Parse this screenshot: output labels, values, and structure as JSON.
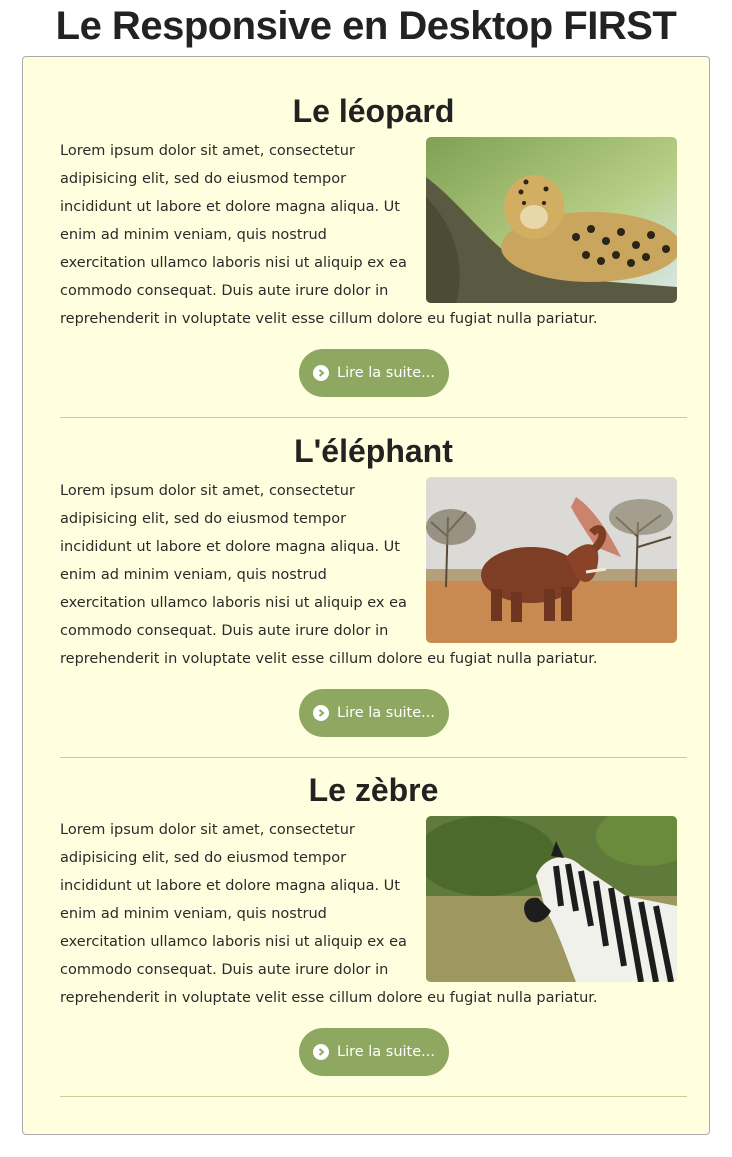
{
  "page": {
    "title": "Le Responsive en Desktop FIRST"
  },
  "articles": [
    {
      "title": "Le léopard",
      "text": "Lorem ipsum dolor sit amet, consectetur adipisicing elit, sed do eiusmod tempor incididunt ut labore et dolore magna aliqua. Ut enim ad minim veniam, quis nostrud exercitation ullamco laboris nisi ut aliquip ex ea commodo consequat. Duis aute irure dolor in reprehenderit in voluptate velit esse cillum dolore eu fugiat nulla pariatur.",
      "button_label": "Lire la suite..."
    },
    {
      "title": "L'éléphant",
      "text": "Lorem ipsum dolor sit amet, consectetur adipisicing elit, sed do eiusmod tempor incididunt ut labore et dolore magna aliqua. Ut enim ad minim veniam, quis nostrud exercitation ullamco laboris nisi ut aliquip ex ea commodo consequat. Duis aute irure dolor in reprehenderit in voluptate velit esse cillum dolore eu fugiat nulla pariatur.",
      "button_label": "Lire la suite..."
    },
    {
      "title": "Le zèbre",
      "text": "Lorem ipsum dolor sit amet, consectetur adipisicing elit, sed do eiusmod tempor incididunt ut labore et dolore magna aliqua. Ut enim ad minim veniam, quis nostrud exercitation ullamco laboris nisi ut aliquip ex ea commodo consequat. Duis aute irure dolor in reprehenderit in voluptate velit esse cillum dolore eu fugiat nulla pariatur.",
      "button_label": "Lire la suite..."
    }
  ],
  "colors": {
    "panel_background": "#ffffe0",
    "button_background": "#8ea862",
    "divider": "#c9cf8e",
    "text": "#222222"
  },
  "icons": {
    "button_icon": "chevron-circle-right-icon"
  }
}
